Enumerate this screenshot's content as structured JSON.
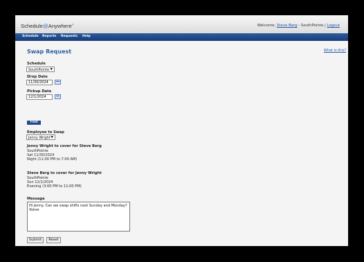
{
  "header": {
    "logo_text": "Schedule",
    "logo_mark": "@",
    "logo_suffix": "Anywhere",
    "welcome_prefix": "Welcome,",
    "user_name": "Steve Berg",
    "location_sep": "- SouthPointe |",
    "logout": "Logout"
  },
  "nav": [
    "Schedule",
    "Reports",
    "Requests",
    "Help"
  ],
  "page": {
    "title": "Swap Request",
    "help_link": "What is this?"
  },
  "form": {
    "schedule_label": "Schedule",
    "schedule_value": "SouthPointe",
    "drop_label": "Drop Date",
    "drop_value": "11/30/2024",
    "pickup_label": "Pickup Date",
    "pickup_value": "12/1/2024",
    "find_button": "Find",
    "employee_label": "Employee to Swap",
    "employee_value": "Jenny Wright"
  },
  "swaps": [
    {
      "heading": "Jenny Wright to cover for Steve Berg",
      "location": "SouthPointe",
      "date": "Sat 11/30/2024",
      "shift": "Night (11:00 PM to 7:00 AM)"
    },
    {
      "heading": "Steve Berg to cover for Jenny Wright",
      "location": "SouthPointe",
      "date": "Sun 12/1/2024",
      "shift": "Evening (3:00 PM to 11:00 PM)"
    }
  ],
  "message": {
    "label": "Message",
    "value": "Hi Jenny. Can we swap shifts next Sunday and Monday?\nSteve"
  },
  "buttons": {
    "submit": "Submit",
    "reset": "Reset"
  }
}
